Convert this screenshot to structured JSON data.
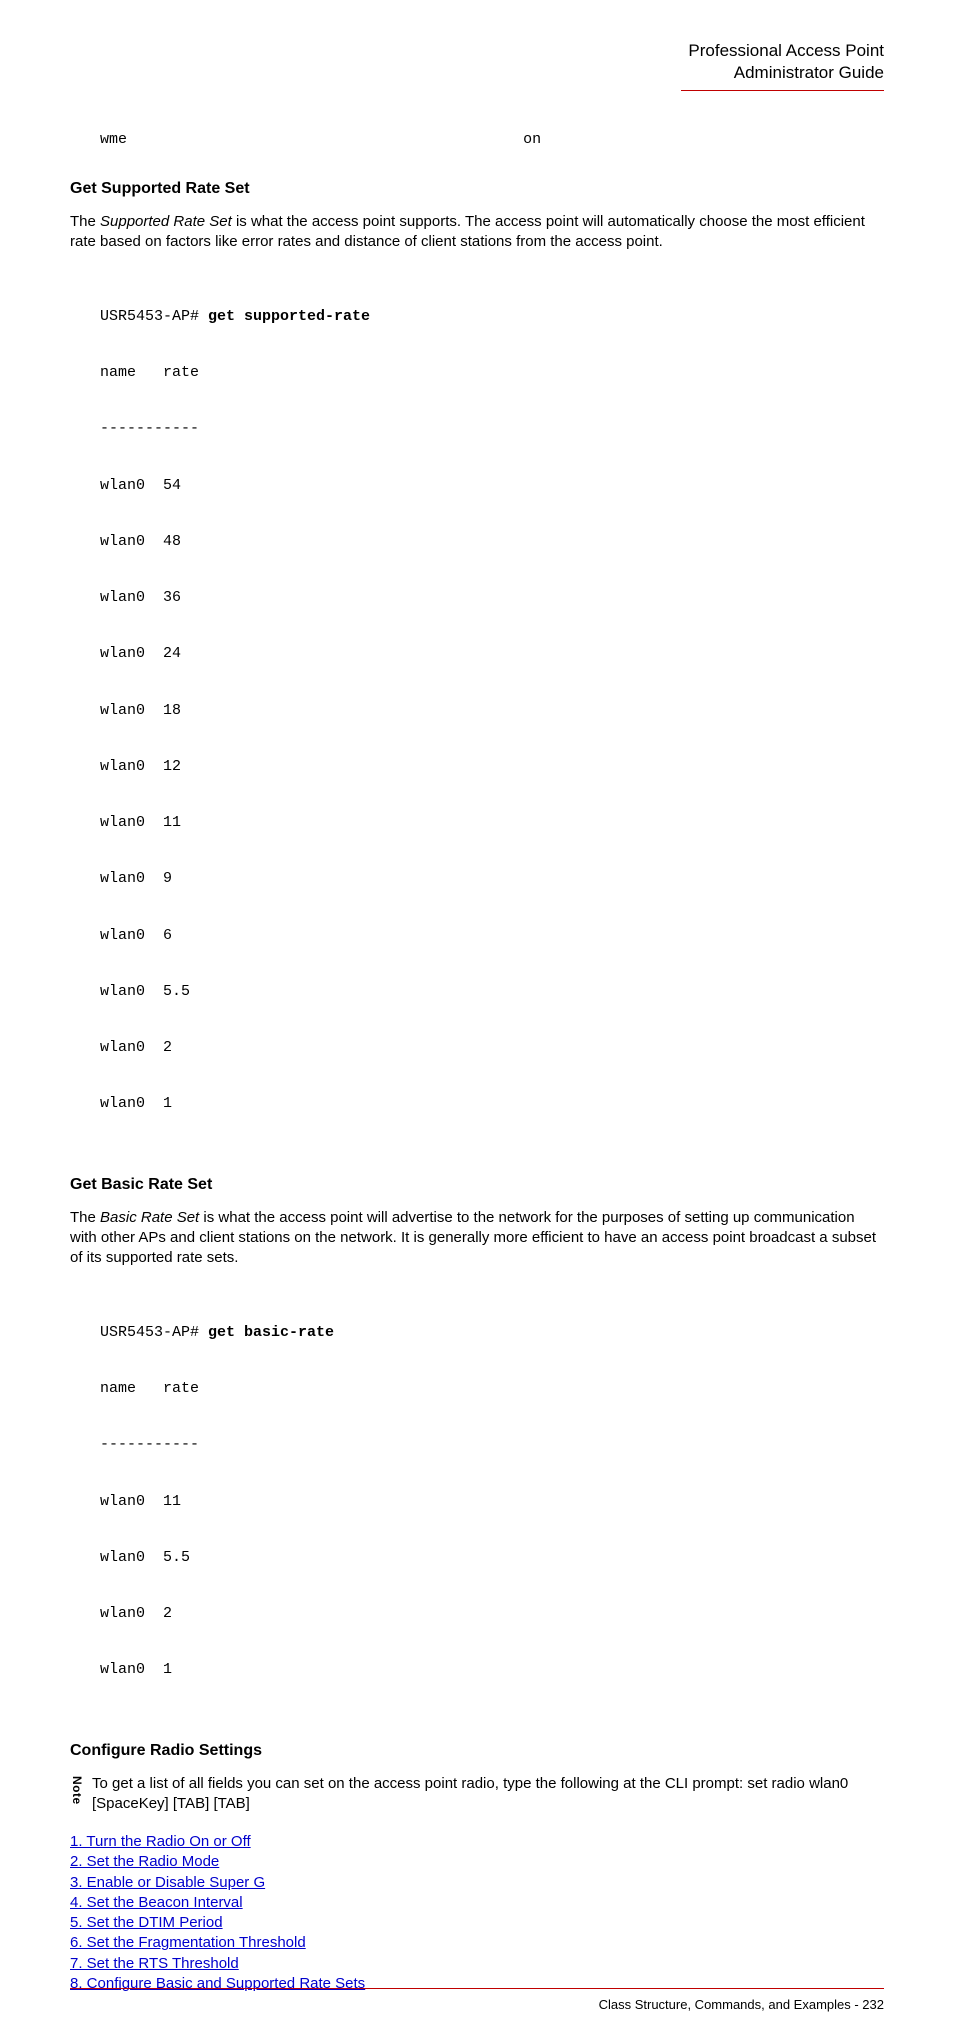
{
  "header": {
    "line1": "Professional Access Point",
    "line2": "Administrator Guide"
  },
  "wme": {
    "label": "wme",
    "value": "on"
  },
  "section1": {
    "title": "Get Supported Rate Set",
    "para_pre": "The ",
    "para_italic": "Supported Rate Set",
    "para_post": " is what the access point supports. The access point will automatically choose the most efficient rate based on factors like error rates and distance of client stations from the access point.",
    "prompt": "USR5453-AP# ",
    "cmd": "get supported-rate",
    "hdr": "name   rate",
    "sep": "-----------",
    "rows": [
      "wlan0  54",
      "wlan0  48",
      "wlan0  36",
      "wlan0  24",
      "wlan0  18",
      "wlan0  12",
      "wlan0  11",
      "wlan0  9",
      "wlan0  6",
      "wlan0  5.5",
      "wlan0  2",
      "wlan0  1"
    ]
  },
  "section2": {
    "title": "Get Basic Rate Set",
    "para_pre": "The ",
    "para_italic": "Basic Rate Set",
    "para_post": " is what the access point will advertise to the network for the purposes of setting up communication with other APs and client stations on the network. It is generally more efficient to have an access point broadcast a subset of its supported rate sets.",
    "prompt": "USR5453-AP# ",
    "cmd": "get basic-rate",
    "hdr": "name   rate",
    "sep": "-----------",
    "rows": [
      "wlan0  11",
      "wlan0  5.5",
      "wlan0  2",
      "wlan0  1"
    ]
  },
  "section3": {
    "title": "Configure Radio Settings",
    "note_label": "Note",
    "note_text": "To get a list of all fields you can set on the access point radio, type the following at the CLI prompt: set radio wlan0 [SpaceKey] [TAB] [TAB]",
    "links": [
      "1. Turn the Radio On or Off",
      "2. Set the Radio Mode",
      "3. Enable or Disable Super G",
      "4. Set the Beacon Interval",
      "5. Set the DTIM Period",
      "6. Set the Fragmentation Threshold",
      "7. Set the RTS Threshold",
      "8. Configure Basic and Supported Rate Sets"
    ]
  },
  "footer": {
    "text": "Class Structure, Commands, and Examples - 232"
  }
}
